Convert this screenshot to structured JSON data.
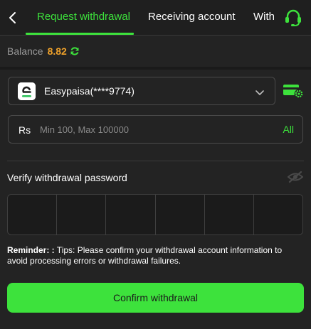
{
  "header": {
    "back_icon": "chevron-left-icon",
    "tabs": [
      {
        "label": "Request withdrawal",
        "active": true
      },
      {
        "label": "Receiving account",
        "active": false
      },
      {
        "label": "With",
        "active": false
      }
    ],
    "support_icon": "headset-icon"
  },
  "balance": {
    "label": "Balance",
    "value": "8.82",
    "value_color": "#f0a22b",
    "refresh_icon": "refresh-icon"
  },
  "account": {
    "logo_icon": "easypaisa-logo-icon",
    "name": "Easypaisa(****9774)",
    "chevron_icon": "chevron-down-icon",
    "manage_icon": "card-settings-icon"
  },
  "amount": {
    "currency": "Rs",
    "placeholder": "Min 100, Max 100000",
    "value": "",
    "all_label": "All"
  },
  "password": {
    "label": "Verify withdrawal password",
    "visibility_icon": "eye-off-icon",
    "digits": [
      "",
      "",
      "",
      "",
      "",
      ""
    ]
  },
  "reminder": {
    "label": "Reminder: :",
    "text": " Tips: Please confirm your withdrawal account information to avoid processing errors or withdrawal failures."
  },
  "confirm": {
    "label": "Confirm withdrawal"
  },
  "colors": {
    "accent": "#3de23c",
    "background": "#232323",
    "balance": "#f0a22b"
  }
}
